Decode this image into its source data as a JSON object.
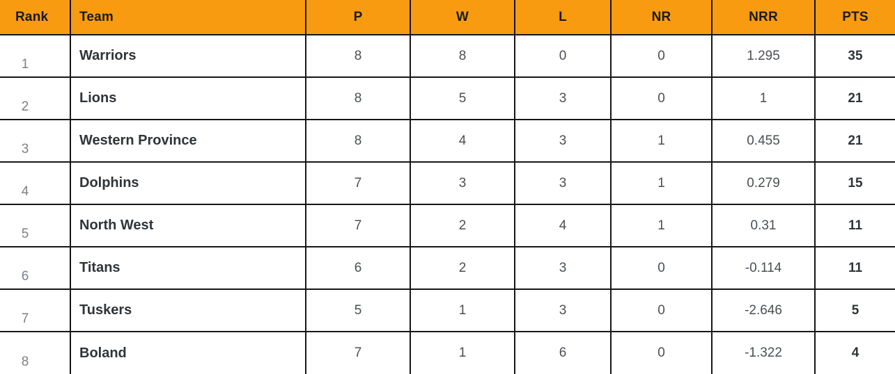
{
  "theme": {
    "header_bg": "#F99B10",
    "header_text": "#1a1a1a",
    "grid_line": "#161616",
    "cell_text": "#4a4f54",
    "team_text": "#2f3438",
    "rank_text": "#7b8086"
  },
  "table": {
    "columns": [
      {
        "key": "rank",
        "label": "Rank"
      },
      {
        "key": "team",
        "label": "Team"
      },
      {
        "key": "p",
        "label": "P"
      },
      {
        "key": "w",
        "label": "W"
      },
      {
        "key": "l",
        "label": "L"
      },
      {
        "key": "nr",
        "label": "NR"
      },
      {
        "key": "nrr",
        "label": "NRR"
      },
      {
        "key": "pts",
        "label": "PTS"
      }
    ],
    "rows": [
      {
        "rank": "1",
        "team": "Warriors",
        "p": "8",
        "w": "8",
        "l": "0",
        "nr": "0",
        "nrr": "1.295",
        "pts": "35"
      },
      {
        "rank": "2",
        "team": "Lions",
        "p": "8",
        "w": "5",
        "l": "3",
        "nr": "0",
        "nrr": "1",
        "pts": "21"
      },
      {
        "rank": "3",
        "team": "Western Province",
        "p": "8",
        "w": "4",
        "l": "3",
        "nr": "1",
        "nrr": "0.455",
        "pts": "21"
      },
      {
        "rank": "4",
        "team": "Dolphins",
        "p": "7",
        "w": "3",
        "l": "3",
        "nr": "1",
        "nrr": "0.279",
        "pts": "15"
      },
      {
        "rank": "5",
        "team": "North West",
        "p": "7",
        "w": "2",
        "l": "4",
        "nr": "1",
        "nrr": "0.31",
        "pts": "11"
      },
      {
        "rank": "6",
        "team": "Titans",
        "p": "6",
        "w": "2",
        "l": "3",
        "nr": "0",
        "nrr": "-0.114",
        "pts": "11"
      },
      {
        "rank": "7",
        "team": "Tuskers",
        "p": "5",
        "w": "1",
        "l": "3",
        "nr": "0",
        "nrr": "-2.646",
        "pts": "5"
      },
      {
        "rank": "8",
        "team": "Boland",
        "p": "7",
        "w": "1",
        "l": "6",
        "nr": "0",
        "nrr": "-1.322",
        "pts": "4"
      }
    ]
  }
}
